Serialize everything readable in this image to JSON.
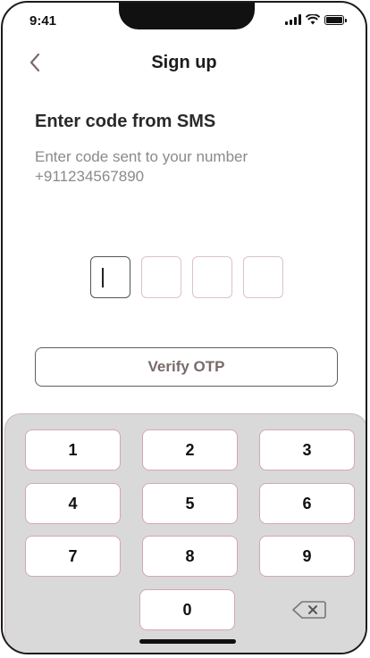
{
  "status_bar": {
    "time": "9:41"
  },
  "header": {
    "title": "Sign up"
  },
  "content": {
    "heading": "Enter code from SMS",
    "subtext_line1": "Enter code sent to your number",
    "subtext_line2": "+911234567890"
  },
  "otp": {
    "digits": [
      "",
      "",
      "",
      ""
    ],
    "active_index": 0
  },
  "verify_button": {
    "label": "Verify OTP"
  },
  "keypad": {
    "keys": [
      "1",
      "2",
      "3",
      "4",
      "5",
      "6",
      "7",
      "8",
      "9",
      "0"
    ]
  },
  "icons": {
    "back": "chevron-left-icon",
    "backspace": "backspace-icon",
    "signal": "cellular-signal-icon",
    "wifi": "wifi-icon",
    "battery": "battery-icon"
  },
  "colors": {
    "key_border": "#d5a7b2",
    "otp_border": "#dcc2c8",
    "keypad_bg": "#d9d9d9",
    "verify_text": "#7a6a6a"
  }
}
